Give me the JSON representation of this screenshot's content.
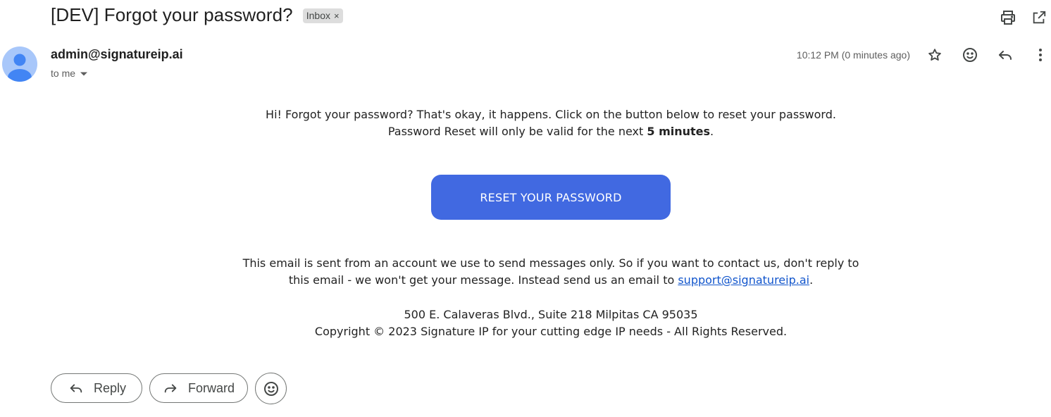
{
  "email": {
    "subject": "[DEV] Forgot your password?",
    "label": "Inbox",
    "label_remove": "×",
    "sender": "admin@signatureip.ai",
    "recipient": "to me",
    "timestamp": "10:12 PM (0 minutes ago)"
  },
  "body": {
    "intro_line1": "Hi! Forgot your password? That's okay, it happens. Click on the button below to reset your password.",
    "intro_line2_prefix": "Password Reset will only be valid for the next ",
    "intro_line2_bold": "5 minutes",
    "intro_line2_suffix": ".",
    "reset_button": "RESET YOUR PASSWORD",
    "notice_line1": "This email is sent from an account we use to send messages only. So if you want to contact us, don't reply to",
    "notice_line2_prefix": "this email - we won't get your message. Instead send us an email to ",
    "support_link": "support@signatureip.ai",
    "notice_line2_suffix": ".",
    "address": "500 E. Calaveras Blvd., Suite 218 Milpitas CA 95035",
    "copyright": "Copyright © 2023 Signature IP for your cutting edge IP needs - All Rights Reserved."
  },
  "actions": {
    "reply": "Reply",
    "forward": "Forward"
  },
  "icons": {
    "print": "print-icon",
    "open_new_window": "open-in-new-window-icon",
    "star": "star-icon",
    "emoji": "emoji-icon",
    "reply": "reply-icon",
    "more": "more-vertical-icon",
    "forward": "forward-icon",
    "avatar": "person-icon"
  },
  "colors": {
    "accent_button": "#4169e1",
    "link": "#1155cc",
    "avatar_bg": "#a8c7fa",
    "avatar_fg": "#4285f4"
  }
}
